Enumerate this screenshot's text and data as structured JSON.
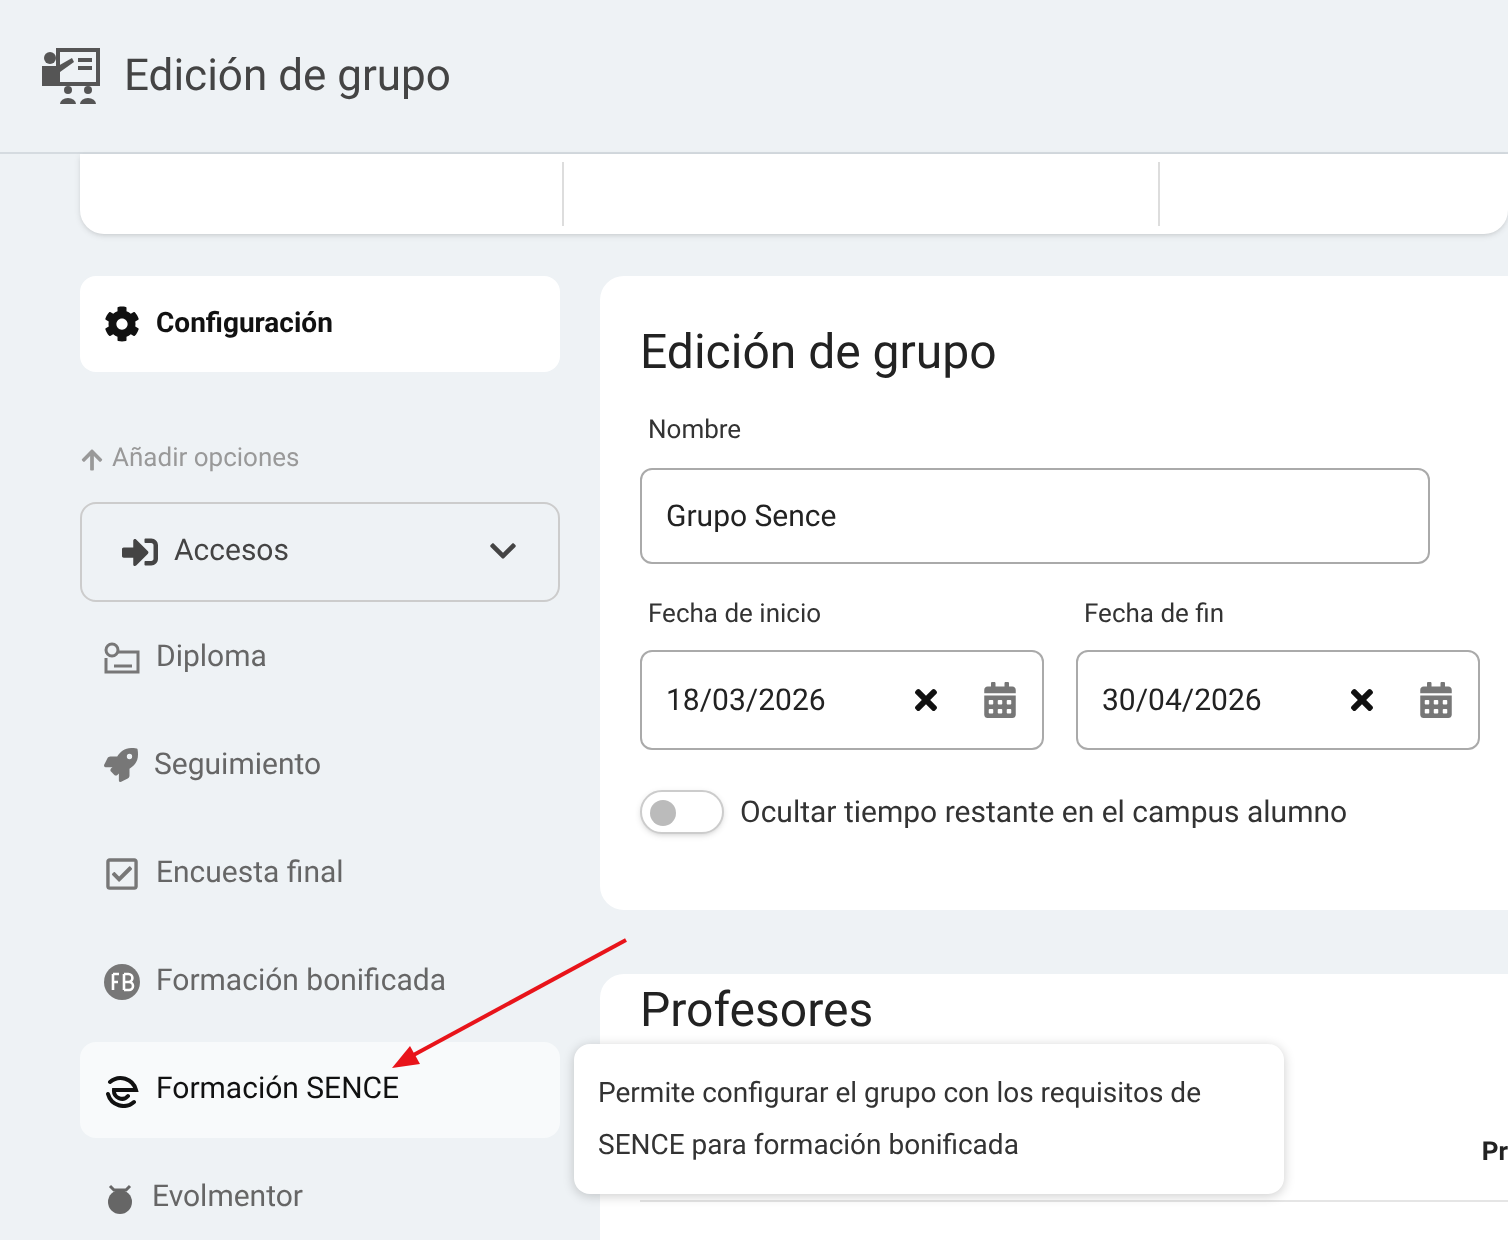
{
  "header": {
    "title": "Edición de grupo"
  },
  "sidebar": {
    "config_item": {
      "label": "Configuración",
      "selected": true
    },
    "add_options_label": "Añadir opciones",
    "accesos": {
      "label": "Accesos",
      "expanded": false
    },
    "items": [
      {
        "label": "Diploma",
        "kind": "diploma",
        "hovered": false
      },
      {
        "label": "Seguimiento",
        "kind": "rocket",
        "hovered": false
      },
      {
        "label": "Encuesta final",
        "kind": "survey",
        "hovered": false
      },
      {
        "label": "Formación bonificada",
        "kind": "fb",
        "hovered": false
      },
      {
        "label": "Formación SENCE",
        "kind": "sence",
        "hovered": true
      },
      {
        "label": "Evolmentor",
        "kind": "evol",
        "hovered": false
      }
    ]
  },
  "group_card": {
    "title": "Edición de grupo",
    "name_label": "Nombre",
    "name_value": "Grupo Sence",
    "start_label": "Fecha de inicio",
    "start_value": "18/03/2026",
    "end_label": "Fecha de fin",
    "end_value": "30/04/2026",
    "toggle": {
      "label": "Ocultar tiempo restante en el campus alumno",
      "on": false
    }
  },
  "teachers_card": {
    "title": "Profesores",
    "column_1": "Pr"
  },
  "tooltip": {
    "text": "Permite configurar el grupo con los requisitos de SENCE para formación bonificada"
  }
}
